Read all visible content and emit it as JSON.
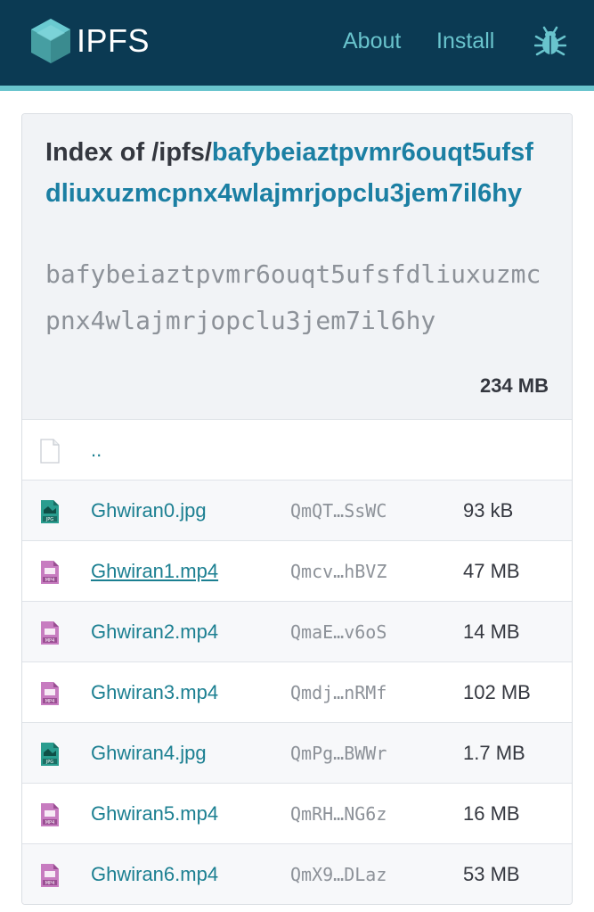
{
  "header": {
    "brand": "IPFS",
    "nav": {
      "about": "About",
      "install": "Install"
    },
    "logo_icon": "ipfs-cube-icon",
    "bug_icon": "bug-icon",
    "colors": {
      "bar": "#0b3a53",
      "accent": "#69c4cd"
    }
  },
  "index": {
    "title_prefix": "Index of /ipfs/",
    "cid": "bafybeiaztpvmr6ouqt5ufsfdliuxuzmcpnx4wlajmrjopclu3jem7il6hy",
    "total_size": "234 MB"
  },
  "parent": {
    "label": "..",
    "icon": "file-icon"
  },
  "files": [
    {
      "name": "Ghwiran0.jpg",
      "hash": "QmQT…SsWC",
      "size": "93 kB",
      "icon": "jpg-file-icon"
    },
    {
      "name": "Ghwiran1.mp4",
      "hash": "Qmcv…hBVZ",
      "size": "47 MB",
      "icon": "mp4-file-icon"
    },
    {
      "name": "Ghwiran2.mp4",
      "hash": "QmaE…v6oS",
      "size": "14 MB",
      "icon": "mp4-file-icon"
    },
    {
      "name": "Ghwiran3.mp4",
      "hash": "Qmdj…nRMf",
      "size": "102 MB",
      "icon": "mp4-file-icon"
    },
    {
      "name": "Ghwiran4.jpg",
      "hash": "QmPg…BWWr",
      "size": "1.7 MB",
      "icon": "jpg-file-icon"
    },
    {
      "name": "Ghwiran5.mp4",
      "hash": "QmRH…NG6z",
      "size": "16 MB",
      "icon": "mp4-file-icon"
    },
    {
      "name": "Ghwiran6.mp4",
      "hash": "QmX9…DLaz",
      "size": "53 MB",
      "icon": "mp4-file-icon"
    }
  ]
}
